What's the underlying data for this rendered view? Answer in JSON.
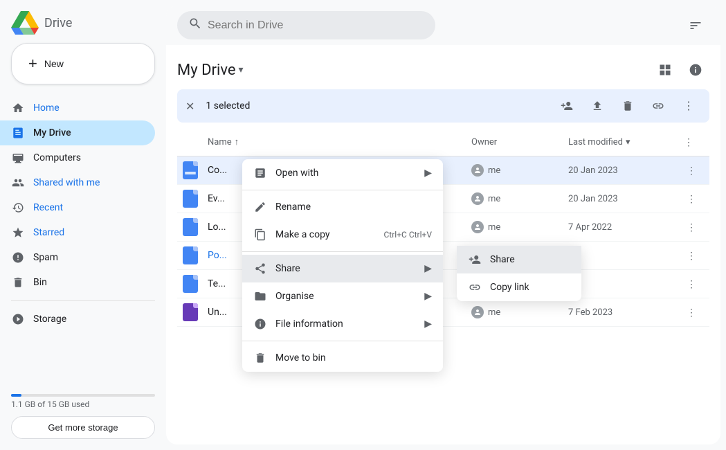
{
  "app": {
    "title": "Drive",
    "search_placeholder": "Search in Drive"
  },
  "sidebar": {
    "new_button": "New",
    "nav_items": [
      {
        "id": "home",
        "label": "Home",
        "icon": "🏠"
      },
      {
        "id": "my-drive",
        "label": "My Drive",
        "icon": "📁",
        "active": true,
        "colored": true
      },
      {
        "id": "computers",
        "label": "Computers",
        "icon": "💻"
      },
      {
        "id": "shared-with-me",
        "label": "Shared with me",
        "icon": "👥",
        "colored": true
      },
      {
        "id": "recent",
        "label": "Recent",
        "icon": "🕐",
        "colored": true
      },
      {
        "id": "starred",
        "label": "Starred",
        "icon": "⭐",
        "colored": true
      },
      {
        "id": "spam",
        "label": "Spam",
        "icon": "🚫"
      },
      {
        "id": "bin",
        "label": "Bin",
        "icon": "🗑️"
      },
      {
        "id": "storage",
        "label": "Storage",
        "icon": "☁️"
      }
    ],
    "storage": {
      "used": "1.1 GB of 15 GB used",
      "percent": 7.3,
      "get_more_label": "Get more storage"
    }
  },
  "main": {
    "drive_title": "My Drive",
    "toolbar": {
      "selected_text": "1 selected"
    },
    "file_list": {
      "columns": {
        "name": "Name",
        "owner": "Owner",
        "last_modified": "Last modified"
      },
      "files": [
        {
          "id": 1,
          "name": "Co...",
          "owner": "me",
          "modified": "20 Jan 2023",
          "selected": true
        },
        {
          "id": 2,
          "name": "Ev...",
          "owner": "me",
          "modified": "20 Jan 2023",
          "selected": false
        },
        {
          "id": 3,
          "name": "Lo...",
          "owner": "me",
          "modified": "7 Apr 2022",
          "selected": false
        },
        {
          "id": 4,
          "name": "Po...",
          "owner": "",
          "modified": "",
          "selected": false,
          "colored": true
        },
        {
          "id": 5,
          "name": "Te...",
          "owner": "",
          "modified": "",
          "selected": false
        },
        {
          "id": 6,
          "name": "Un...",
          "owner": "me",
          "modified": "7 Feb 2023",
          "selected": false
        }
      ]
    },
    "context_menu": {
      "items": [
        {
          "id": "open-with",
          "label": "Open with",
          "has_arrow": true
        },
        {
          "id": "rename",
          "label": "Rename"
        },
        {
          "id": "make-copy",
          "label": "Make a copy",
          "shortcut": "Ctrl+C Ctrl+V"
        },
        {
          "id": "share",
          "label": "Share",
          "has_arrow": true,
          "active": true
        },
        {
          "id": "organise",
          "label": "Organise",
          "has_arrow": true
        },
        {
          "id": "file-information",
          "label": "File information",
          "has_arrow": true
        },
        {
          "id": "move-to-bin",
          "label": "Move to bin"
        }
      ],
      "submenu": {
        "items": [
          {
            "id": "share-sub",
            "label": "Share",
            "active": true
          },
          {
            "id": "copy-link",
            "label": "Copy link"
          }
        ]
      }
    }
  }
}
